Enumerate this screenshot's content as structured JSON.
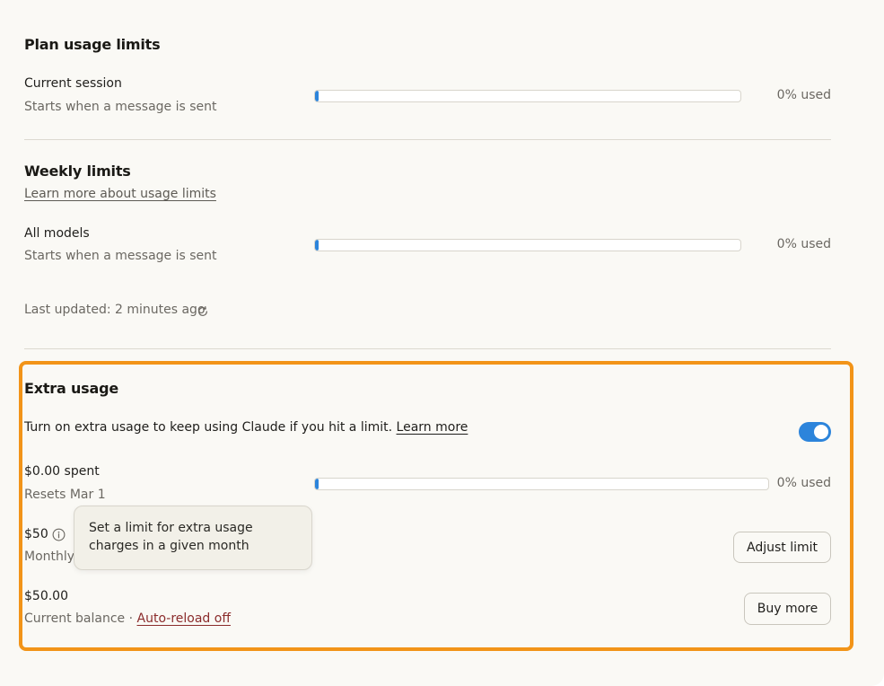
{
  "plan": {
    "title": "Plan usage limits",
    "current_session": {
      "label": "Current session",
      "sub": "Starts when a message is sent",
      "used_text": "0% used",
      "used_fraction": 0
    }
  },
  "weekly": {
    "title": "Weekly limits",
    "learn_more": "Learn more about usage limits",
    "all_models": {
      "label": "All models",
      "sub": "Starts when a message is sent",
      "used_text": "0% used",
      "used_fraction": 0
    },
    "last_updated": "Last updated: 2 minutes ago"
  },
  "extra": {
    "title": "Extra usage",
    "description": "Turn on extra usage to keep using Claude if you hit a limit.",
    "learn_more": "Learn more",
    "toggle_on": true,
    "spent": {
      "label": "$0.00 spent",
      "sub": "Resets Mar 1",
      "used_text": "0% used",
      "used_fraction": 0
    },
    "limit": {
      "amount": "$50",
      "sub": "Monthly",
      "tooltip": "Set a limit for extra usage charges in a given month",
      "button": "Adjust limit"
    },
    "balance": {
      "amount": "$50.00",
      "sub": "Current balance",
      "separator": "·",
      "auto_reload": "Auto-reload off",
      "button": "Buy more"
    }
  },
  "colors": {
    "accent": "#2c84db",
    "highlight_border": "#f29418",
    "background": "#faf9f5"
  }
}
